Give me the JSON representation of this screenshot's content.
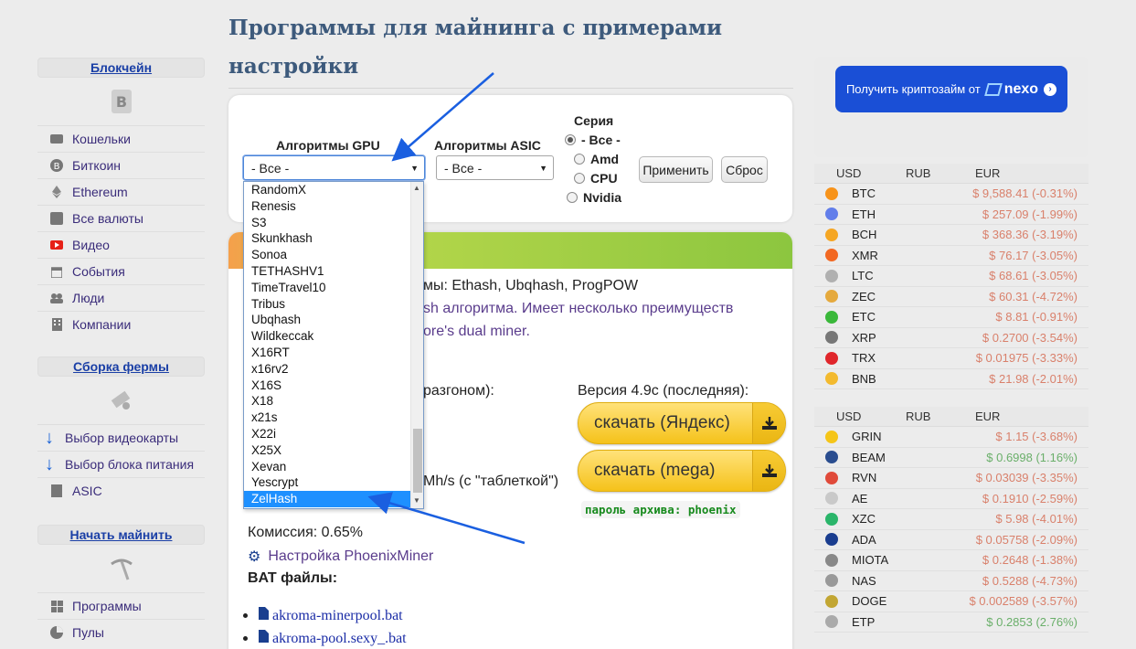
{
  "page": {
    "title_line1": "Программы для майнинга с примерами",
    "title_line2": "настройки"
  },
  "sidebar": {
    "blockchain": {
      "heading": "Блокчейн",
      "items": [
        {
          "label": "Кошельки",
          "icon": "wallet-icon"
        },
        {
          "label": "Биткоин",
          "icon": "bitcoin-icon"
        },
        {
          "label": "Ethereum",
          "icon": "ethereum-icon"
        },
        {
          "label": "Все валюты",
          "icon": "coins-icon"
        },
        {
          "label": "Видео",
          "icon": "youtube-icon"
        },
        {
          "label": "События",
          "icon": "calendar-icon"
        },
        {
          "label": "Люди",
          "icon": "people-icon"
        },
        {
          "label": "Компании",
          "icon": "building-icon"
        }
      ]
    },
    "farm": {
      "heading": "Сборка фермы",
      "items": [
        {
          "label": "Выбор видеокарты",
          "icon": "arrow-down-icon"
        },
        {
          "label": "Выбор блока питания",
          "icon": "arrow-down-icon"
        },
        {
          "label": "ASIC",
          "icon": "chip-icon"
        }
      ]
    },
    "start": {
      "heading": "Начать майнить",
      "items": [
        {
          "label": "Программы",
          "icon": "windows-icon"
        },
        {
          "label": "Пулы",
          "icon": "pie-chart-icon"
        }
      ]
    }
  },
  "filters": {
    "gpu_label": "Алгоритмы GPU",
    "gpu_value": "- Все -",
    "asic_label": "Алгоритмы ASIC",
    "asic_value": "- Все -",
    "series_label": "Серия",
    "series_options": [
      "- Все -",
      "Amd",
      "CPU",
      "Nvidia"
    ],
    "series_selected": "- Все -",
    "apply_label": "Применить",
    "reset_label": "Сброс"
  },
  "dropdown": {
    "options": [
      "RandomX",
      "Renesis",
      "S3",
      "Skunkhash",
      "Sonoa",
      "TETHASHV1",
      "TimeTravel10",
      "Tribus",
      "Ubqhash",
      "Wildkeccak",
      "X16RT",
      "x16rv2",
      "X16S",
      "X18",
      "x21s",
      "X22i",
      "X25X",
      "Xevan",
      "Yescrypt",
      "ZelHash"
    ],
    "selected": "ZelHash"
  },
  "content": {
    "algos_text": "мы: Ethash, Ubqhash, ProgPOW",
    "desc_line1": "sh алгоритма. Имеет несколько преимуществ",
    "desc_line2": "ore's dual miner.",
    "overclock_text": "разгоном):",
    "hashrate_text": "Mh/s (с \"таблеткой\")",
    "version_text": "Версия 4.9c (последняя):",
    "download_yandex": "скачать (Яндекс)",
    "download_mega": "скачать (mega)",
    "password_text": "пароль архива: phoenix",
    "commission_text": "Комиссия: 0.65%",
    "setup_link": "Настройка PhoenixMiner",
    "bat_heading": "BAT файлы:",
    "bat_files": [
      "akroma-minerpool.bat",
      "akroma-pool.sexy_.bat"
    ]
  },
  "right": {
    "nexo_text": "Получить криптозайм от",
    "nexo_brand": "nexo",
    "headers": [
      "USD",
      "RUB",
      "EUR"
    ],
    "rates1": [
      {
        "sym": "BTC",
        "val": "$ 9,588.41 (-0.31%)",
        "trend": "neg",
        "color": "#f7931a"
      },
      {
        "sym": "ETH",
        "val": "$ 257.09 (-1.99%)",
        "trend": "neg",
        "color": "#627eea"
      },
      {
        "sym": "BCH",
        "val": "$ 368.36 (-3.19%)",
        "trend": "neg",
        "color": "#f5a623"
      },
      {
        "sym": "XMR",
        "val": "$ 76.17 (-3.05%)",
        "trend": "neg",
        "color": "#f26822"
      },
      {
        "sym": "LTC",
        "val": "$ 68.61 (-3.05%)",
        "trend": "neg",
        "color": "#b0b0b0"
      },
      {
        "sym": "ZEC",
        "val": "$ 60.31 (-4.72%)",
        "trend": "neg",
        "color": "#e5a93d"
      },
      {
        "sym": "ETC",
        "val": "$ 8.81 (-0.91%)",
        "trend": "neg",
        "color": "#3ab83a"
      },
      {
        "sym": "XRP",
        "val": "$ 0.2700 (-3.54%)",
        "trend": "neg",
        "color": "#777777"
      },
      {
        "sym": "TRX",
        "val": "$ 0.01975 (-3.33%)",
        "trend": "neg",
        "color": "#e0262b"
      },
      {
        "sym": "BNB",
        "val": "$ 21.98 (-2.01%)",
        "trend": "neg",
        "color": "#f3ba2f"
      }
    ],
    "rates2": [
      {
        "sym": "GRIN",
        "val": "$ 1.15 (-3.68%)",
        "trend": "neg",
        "color": "#f5c518"
      },
      {
        "sym": "BEAM",
        "val": "$ 0.6998 (1.16%)",
        "trend": "pos",
        "color": "#2a4d8f"
      },
      {
        "sym": "RVN",
        "val": "$ 0.03039 (-3.35%)",
        "trend": "neg",
        "color": "#e04a3a"
      },
      {
        "sym": "AE",
        "val": "$ 0.1910 (-2.59%)",
        "trend": "neg",
        "color": "#c9c9c9"
      },
      {
        "sym": "XZC",
        "val": "$ 5.98 (-4.01%)",
        "trend": "neg",
        "color": "#2ab56a"
      },
      {
        "sym": "ADA",
        "val": "$ 0.05758 (-2.09%)",
        "trend": "neg",
        "color": "#1a3d8f"
      },
      {
        "sym": "MIOTA",
        "val": "$ 0.2648 (-1.38%)",
        "trend": "neg",
        "color": "#888888"
      },
      {
        "sym": "NAS",
        "val": "$ 0.5288 (-4.73%)",
        "trend": "neg",
        "color": "#999999"
      },
      {
        "sym": "DOGE",
        "val": "$ 0.002589 (-3.57%)",
        "trend": "neg",
        "color": "#c2a633"
      },
      {
        "sym": "ETP",
        "val": "$ 0.2853 (2.76%)",
        "trend": "pos",
        "color": "#aaaaaa"
      }
    ]
  }
}
